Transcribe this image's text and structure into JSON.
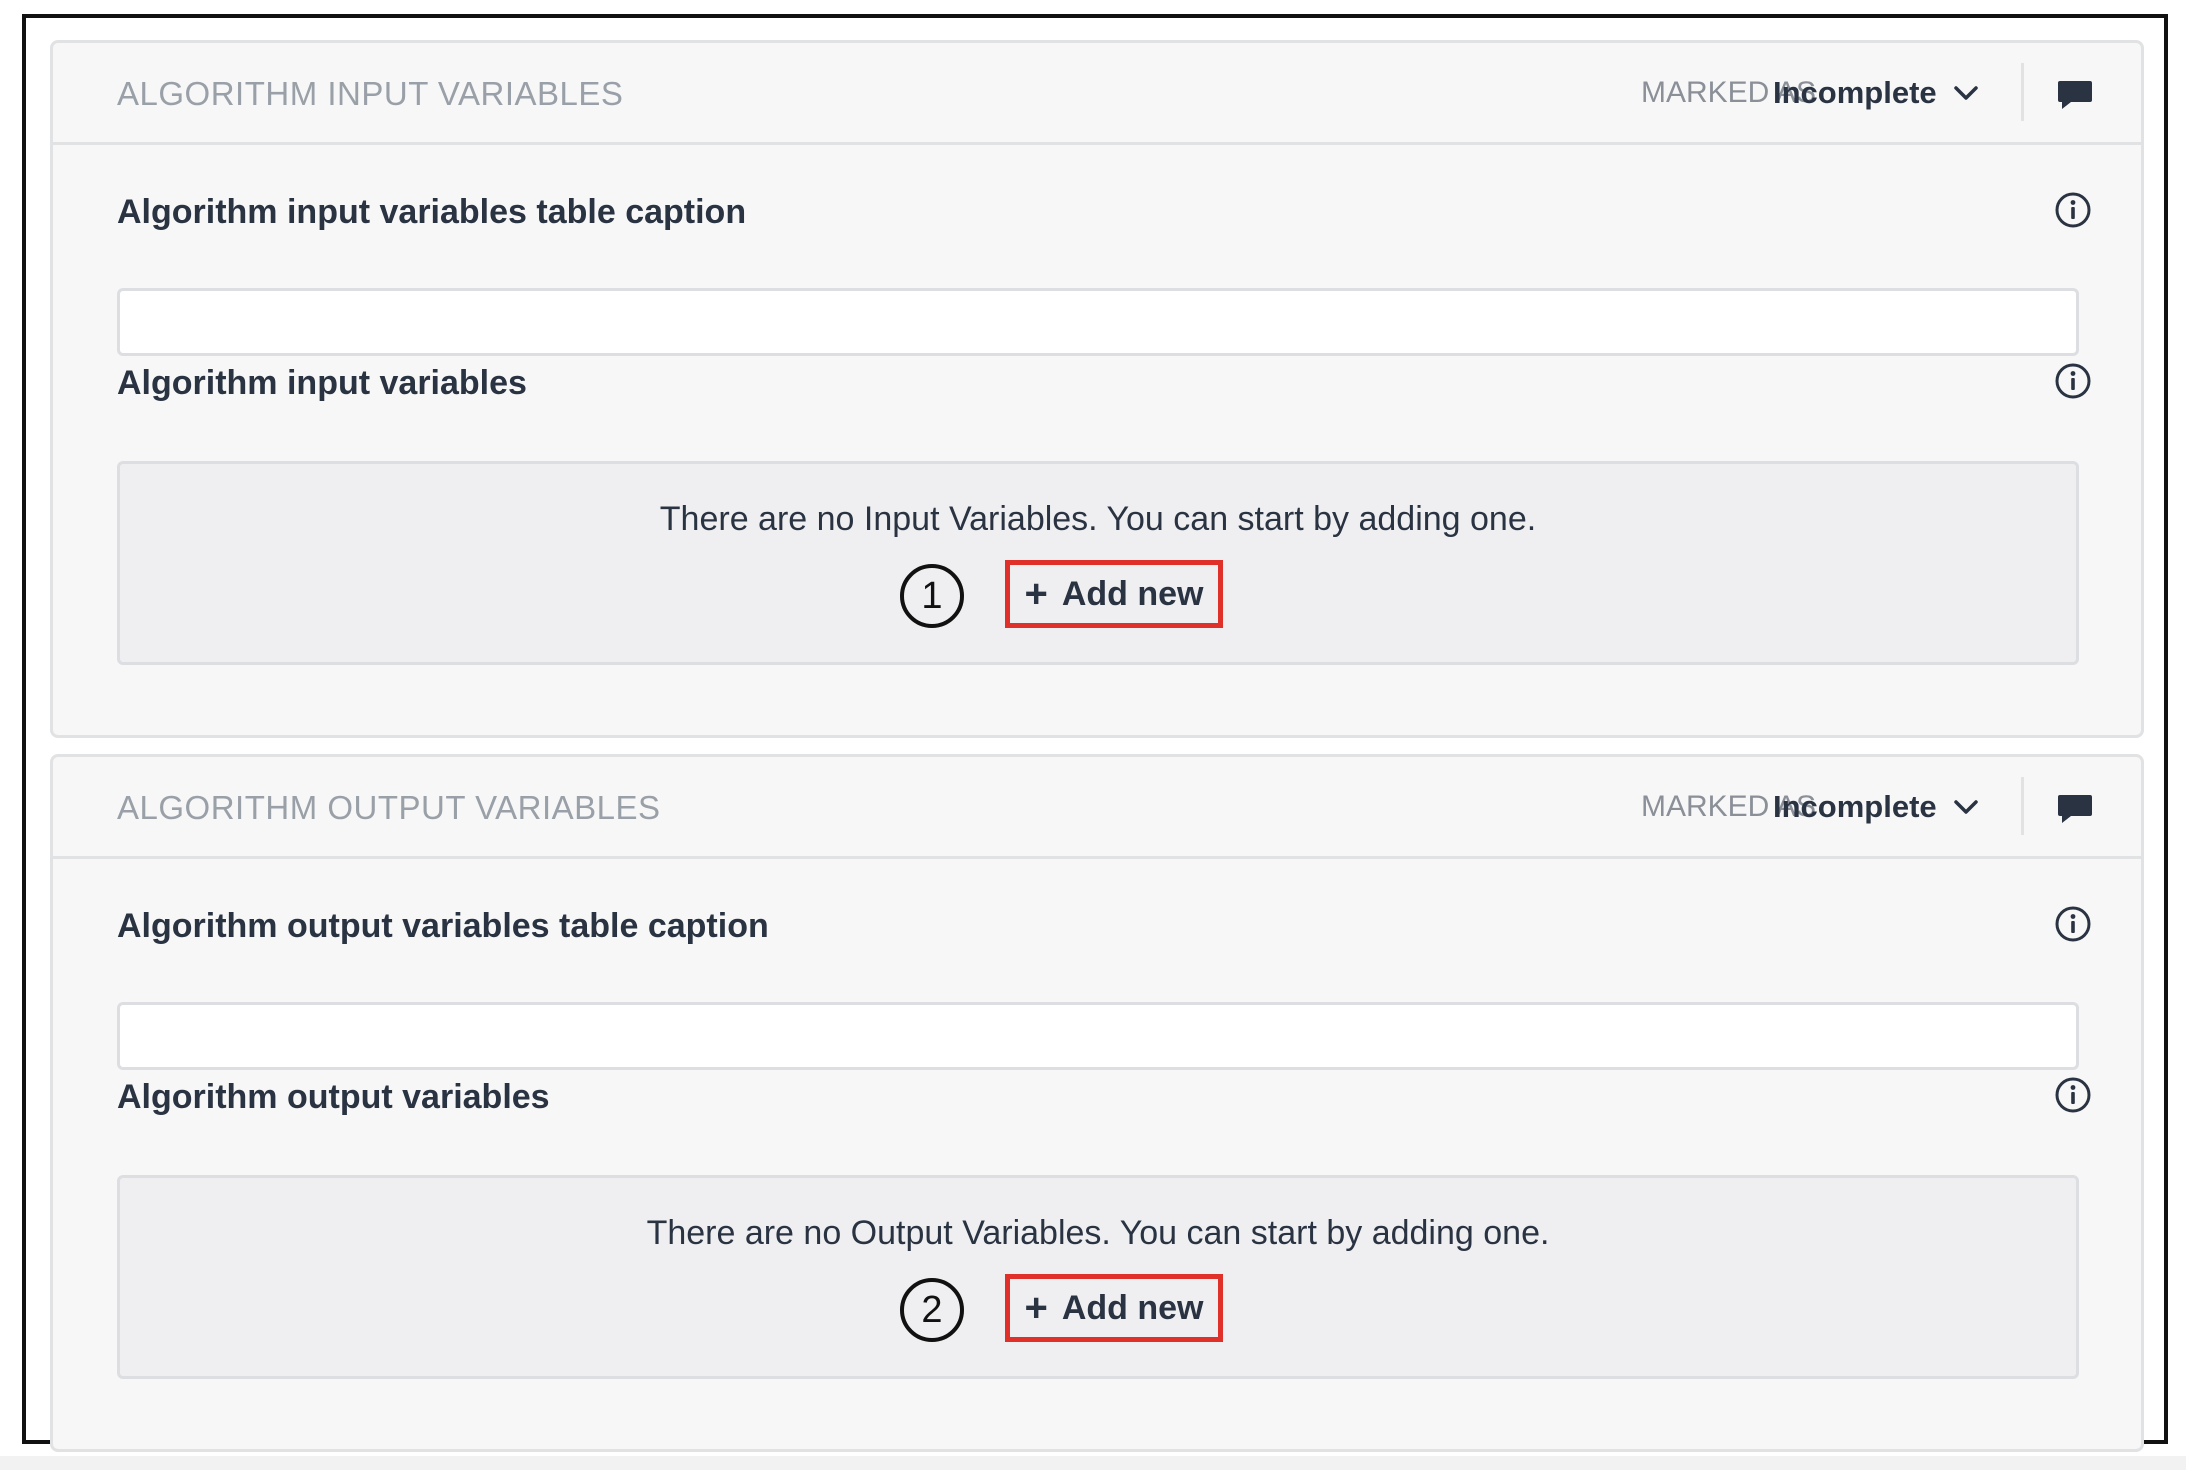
{
  "sections": [
    {
      "title": "ALGORITHM INPUT VARIABLES",
      "marked_as_label": "MARKED AS",
      "status": "Incomplete",
      "caption_label": "Algorithm input variables table caption",
      "caption_value": "",
      "variables_label": "Algorithm input variables",
      "empty_message": "There are no Input Variables. You can start by adding one.",
      "add_plus": "+",
      "add_label": "Add new",
      "step_number": "1"
    },
    {
      "title": "ALGORITHM OUTPUT VARIABLES",
      "marked_as_label": "MARKED AS",
      "status": "Incomplete",
      "caption_label": "Algorithm output variables table caption",
      "caption_value": "",
      "variables_label": "Algorithm output variables",
      "empty_message": "There are no Output Variables. You can start by adding one.",
      "add_plus": "+",
      "add_label": "Add new",
      "step_number": "2"
    }
  ],
  "icons": {
    "status_dropdown": "chevron-down-icon",
    "comment": "comment-icon",
    "info": "info-icon"
  },
  "colors": {
    "highlight_border": "#e0302a",
    "text_dark": "#2a3342",
    "text_muted": "#9aa0a8",
    "panel_background": "#f7f7f7",
    "empty_box_background": "#efeff1"
  }
}
